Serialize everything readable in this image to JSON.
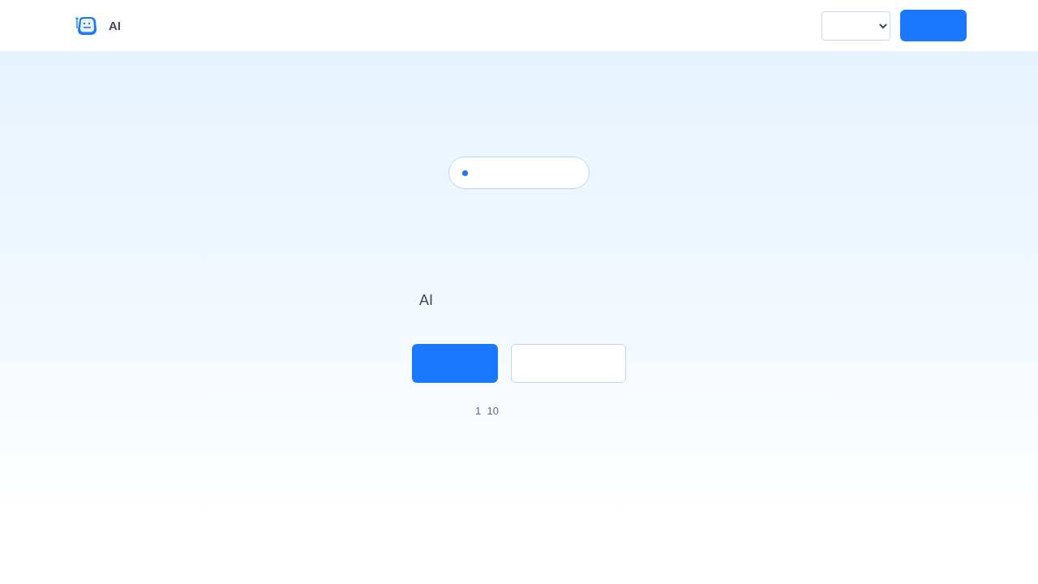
{
  "header": {
    "brand": "AI"
  },
  "hero": {
    "subtitle": "AI",
    "note": "1  10"
  }
}
